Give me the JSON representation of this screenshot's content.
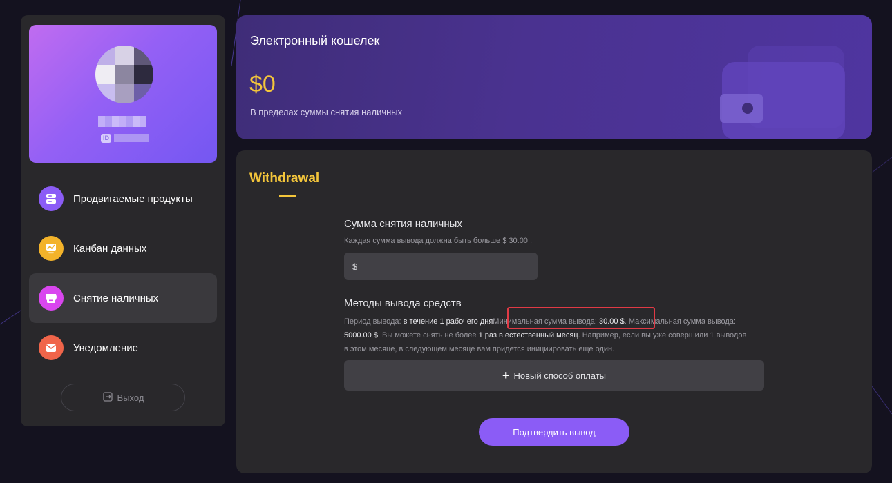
{
  "profile": {
    "id_badge": "ID"
  },
  "nav": {
    "items": [
      {
        "label": "Продвигаемые продукты",
        "icon": "server-icon",
        "color": "#8b5cf6"
      },
      {
        "label": "Канбан данных",
        "icon": "chart-icon",
        "color": "#f3b32a"
      },
      {
        "label": "Снятие наличных",
        "icon": "shop-icon",
        "color": "#d946ef",
        "active": true
      },
      {
        "label": "Уведомление",
        "icon": "mail-icon",
        "color": "#f0654a"
      }
    ],
    "logout_label": "Выход"
  },
  "wallet": {
    "title": "Электронный кошелек",
    "amount": "$0",
    "subtitle": "В пределах суммы снятия наличных"
  },
  "withdrawal": {
    "tab": "Withdrawal",
    "amount_title": "Сумма снятия наличных",
    "amount_hint": "Каждая сумма вывода должна быть больше $ 30.00 .",
    "amount_placeholder": "$",
    "methods_title": "Методы вывода средств",
    "methods_text": {
      "period_label": "Период вывода: ",
      "period_value": "в течение 1 рабочего дня",
      "min_label": "Минимальная сумма вывода: ",
      "min_value": "30.00 $",
      "max_label": ". Максимальная сумма вывода: ",
      "max_value": "5000.00 $",
      "limit_label": ". Вы можете снять не более ",
      "limit_value": "1 раз в естественный месяц",
      "tail": ". Например, если вы уже совершили 1 выводов в этом месяце, в следующем месяце вам придется инициировать еще один."
    },
    "new_method_label": "Новый способ оплаты",
    "confirm_label": "Подтвердить вывод"
  },
  "colors": {
    "accent_yellow": "#f3c53b",
    "accent_purple": "#8b5cf6",
    "highlight_red": "#e03a45"
  }
}
